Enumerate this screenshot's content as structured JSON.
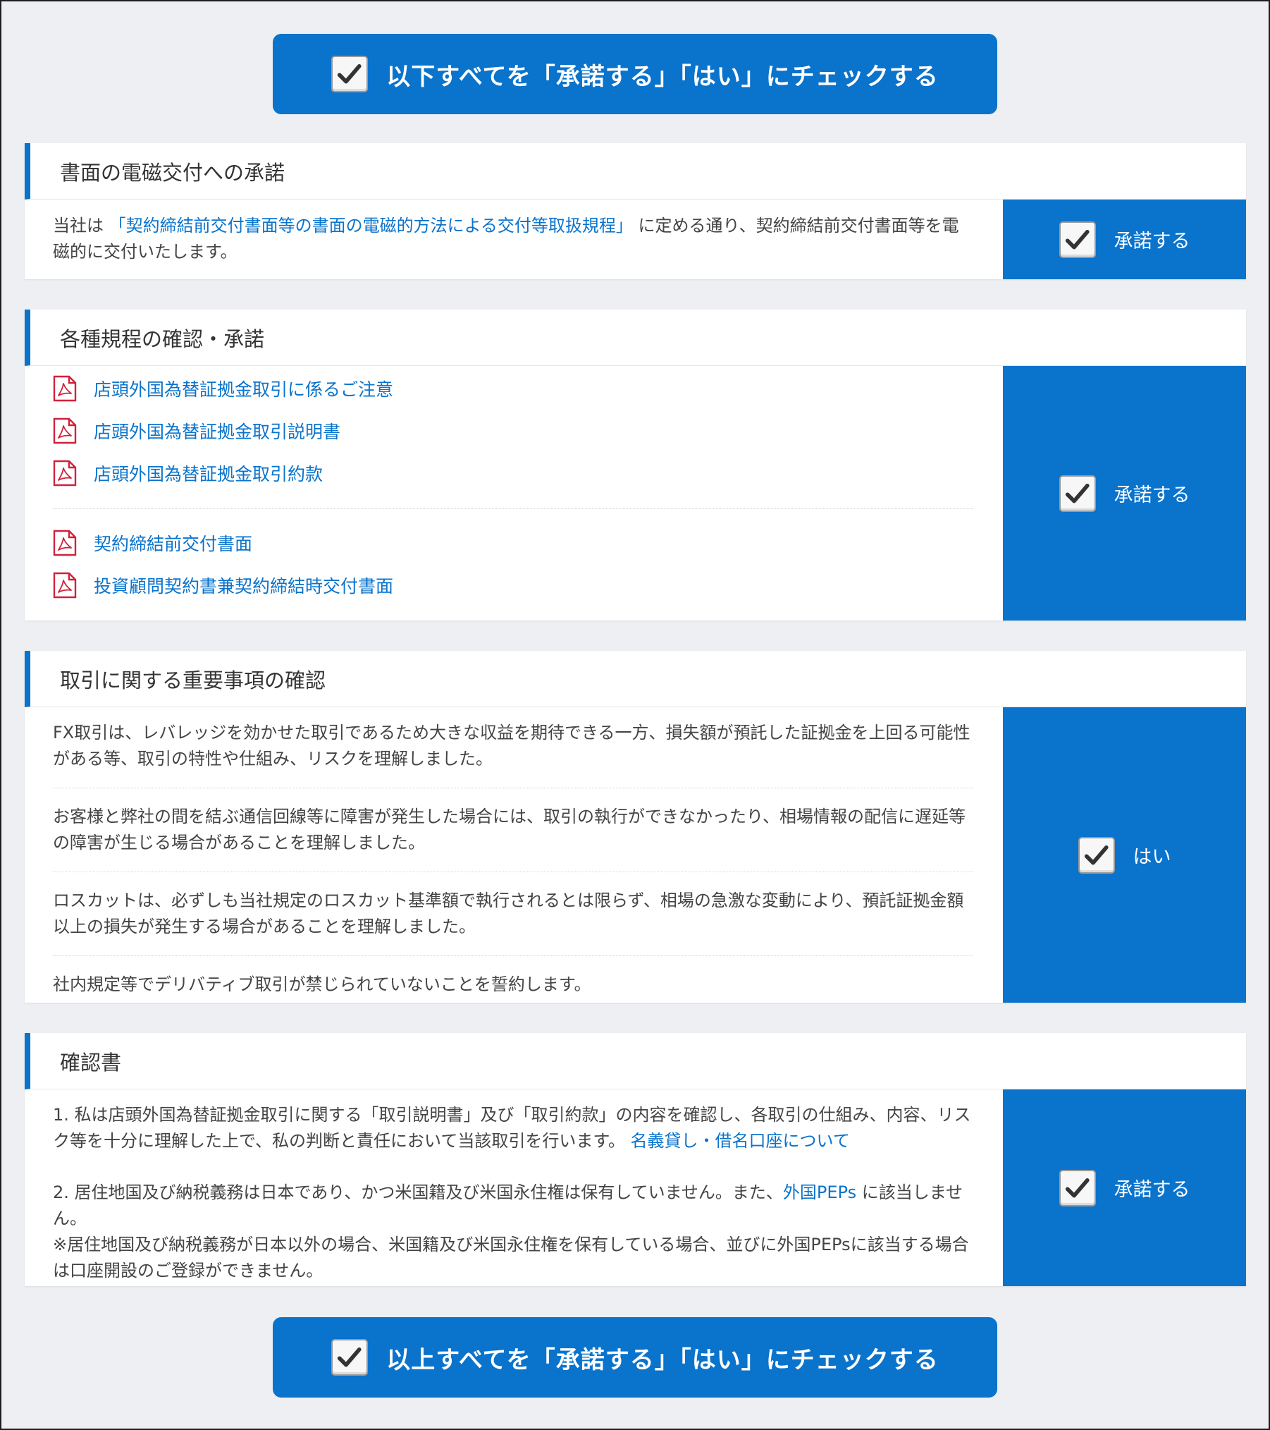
{
  "bulk_top_label": "以下すべてを「承諾する」「はい」にチェックする",
  "bulk_bottom_label": "以上すべてを「承諾する」「はい」にチェックする",
  "colors": {
    "accent": "#0a73cc",
    "background": "#edeff2",
    "pdf_red": "#d0213b"
  },
  "sections": {
    "electronic": {
      "title": "書面の電磁交付への承諾",
      "text_pre": "当社は ",
      "link": "「契約締結前交付書面等の書面の電磁的方法による交付等取扱規程」",
      "text_post": " に定める通り、契約締結前交付書面等を電磁的に交付いたします。",
      "accept_label": "承諾する",
      "checked": true
    },
    "regulations": {
      "title": "各種規程の確認・承諾",
      "group1": [
        "店頭外国為替証拠金取引に係るご注意",
        "店頭外国為替証拠金取引説明書",
        "店頭外国為替証拠金取引約款"
      ],
      "group2": [
        "契約締結前交付書面",
        "投資顧問契約書兼契約締結時交付書面"
      ],
      "accept_label": "承諾する",
      "checked": true
    },
    "important": {
      "title": "取引に関する重要事項の確認",
      "items": [
        "FX取引は、レバレッジを効かせた取引であるため大きな収益を期待できる一方、損失額が預託した証拠金を上回る可能性がある等、取引の特性や仕組み、リスクを理解しました。",
        "お客様と弊社の間を結ぶ通信回線等に障害が発生した場合には、取引の執行ができなかったり、相場情報の配信に遅延等の障害が生じる場合があることを理解しました。",
        "ロスカットは、必ずしも当社規定のロスカット基準額で執行されるとは限らず、相場の急激な変動により、預託証拠金額以上の損失が発生する場合があることを理解しました。",
        "社内規定等でデリバティブ取引が禁じられていないことを誓約します。"
      ],
      "accept_label": "はい",
      "checked": true
    },
    "confirmation": {
      "title": "確認書",
      "p1_text": "1.  私は店頭外国為替証拠金取引に関する「取引説明書」及び「取引約款」の内容を確認し、各取引の仕組み、内容、リスク等を十分に理解した上で、私の判断と責任において当該取引を行います。 ",
      "p1_link": "名義貸し・借名口座について",
      "p2_text": "2.  居住地国及び納税義務は日本であり、かつ米国籍及び米国永住権は保有していません。また、",
      "p2_link": "外国PEPs",
      "p2_post": " に該当しません。",
      "p2_note": "※居住地国及び納税義務が日本以外の場合、米国籍及び米国永住権を保有している場合、並びに外国PEPsに該当する場合は口座開設のご登録ができません。",
      "accept_label": "承諾する",
      "checked": true
    }
  }
}
